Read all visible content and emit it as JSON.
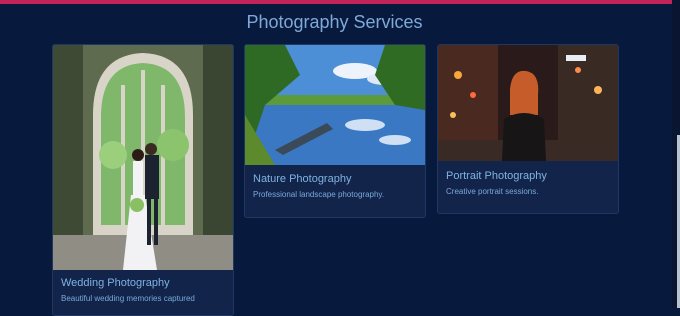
{
  "page": {
    "title": "Photography Services"
  },
  "cards": [
    {
      "title": "Wedding Photography",
      "description": "Beautiful wedding memories captured",
      "image_icon": "wedding-photo"
    },
    {
      "title": "Nature Photography",
      "description": "Professional landscape photography.",
      "image_icon": "nature-photo"
    },
    {
      "title": "Portrait Photography",
      "description": "Creative portrait sessions.",
      "image_icon": "portrait-photo"
    }
  ],
  "colors": {
    "background": "#071a3d",
    "card": "#12244a",
    "accent_bar": "#c2245a",
    "heading": "#7fa8d8"
  }
}
